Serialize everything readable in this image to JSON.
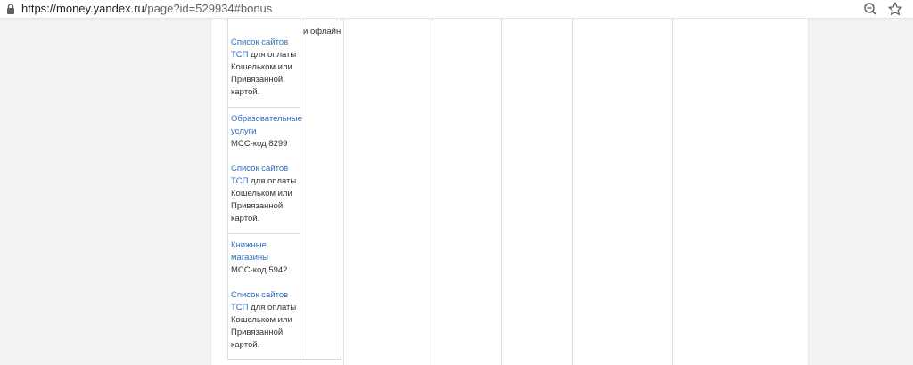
{
  "browser": {
    "url_host": "https://money.yandex.ru",
    "url_path": "/page?id=529934#bonus"
  },
  "table": {
    "col2_text": "и офлайн",
    "rows": [
      {
        "category": "",
        "mcc": "",
        "link": "Список сайтов ТСП",
        "note": "для оплаты Кошельком или Привязанной картой."
      },
      {
        "category": "Образовательные услуги",
        "mcc": "MCC-код 8299",
        "link": "Список сайтов ТСП",
        "note": "для оплаты Кошельком или Привязанной картой."
      },
      {
        "category": "Книжные магазины",
        "mcc": "MCC-код 5942",
        "link": "Список сайтов ТСП",
        "note": "для оплаты Кошельком или Привязанной картой."
      }
    ]
  },
  "icons": {
    "lock": "lock-icon",
    "zoom": "zoom-icon",
    "star": "star-icon"
  },
  "colors": {
    "link": "#2f6fbf",
    "text": "#333333",
    "page_bg": "#f2f2f2"
  }
}
